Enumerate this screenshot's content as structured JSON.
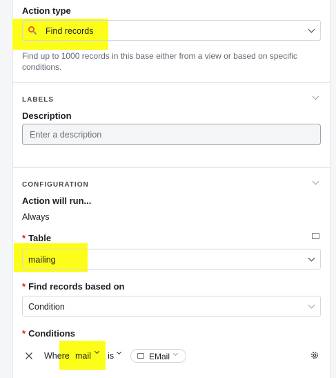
{
  "action_type": {
    "label": "Action type",
    "selected": "Find records",
    "icon": "search-icon",
    "description": "Find up to 1000 records in this base either from a view or based on specific conditions."
  },
  "labels_section": {
    "heading": "LABELS",
    "description_label": "Description",
    "description_placeholder": "Enter a description"
  },
  "configuration": {
    "heading": "CONFIGURATION",
    "action_will_run_label": "Action will run...",
    "action_will_run_value": "Always",
    "table_label": "Table",
    "table_value": "mailing",
    "find_based_on_label": "Find records based on",
    "find_based_on_value": "Condition",
    "conditions_label": "Conditions",
    "required_marker": "*"
  },
  "condition_row": {
    "where": "Where",
    "field": "mail",
    "operator": "is",
    "value": "EMail"
  },
  "colors": {
    "highlight": "#fdfd1a",
    "required": "#d32020",
    "search_icon": "#e8551a"
  }
}
